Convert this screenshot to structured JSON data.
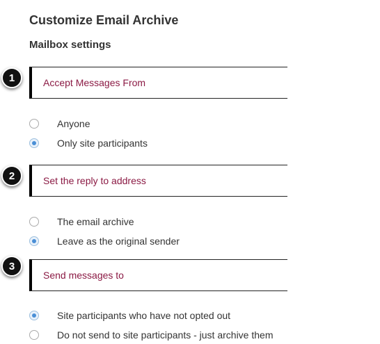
{
  "page": {
    "title": "Customize Email Archive",
    "subtitle": "Mailbox settings"
  },
  "sections": [
    {
      "step": "1",
      "label": "Accept Messages From",
      "options": [
        {
          "label": "Anyone",
          "selected": false
        },
        {
          "label": "Only site participants",
          "selected": true
        }
      ]
    },
    {
      "step": "2",
      "label": "Set the reply to address",
      "options": [
        {
          "label": "The email archive",
          "selected": false
        },
        {
          "label": "Leave as the original sender",
          "selected": true
        }
      ]
    },
    {
      "step": "3",
      "label": "Send messages to",
      "options": [
        {
          "label": "Site participants who have not opted out",
          "selected": true
        },
        {
          "label": "Do not send to site participants - just archive them",
          "selected": false
        }
      ]
    }
  ],
  "colors": {
    "section_label": "#8b1a44",
    "radio_selected": "#4a8fd6",
    "badge": "#111111"
  }
}
